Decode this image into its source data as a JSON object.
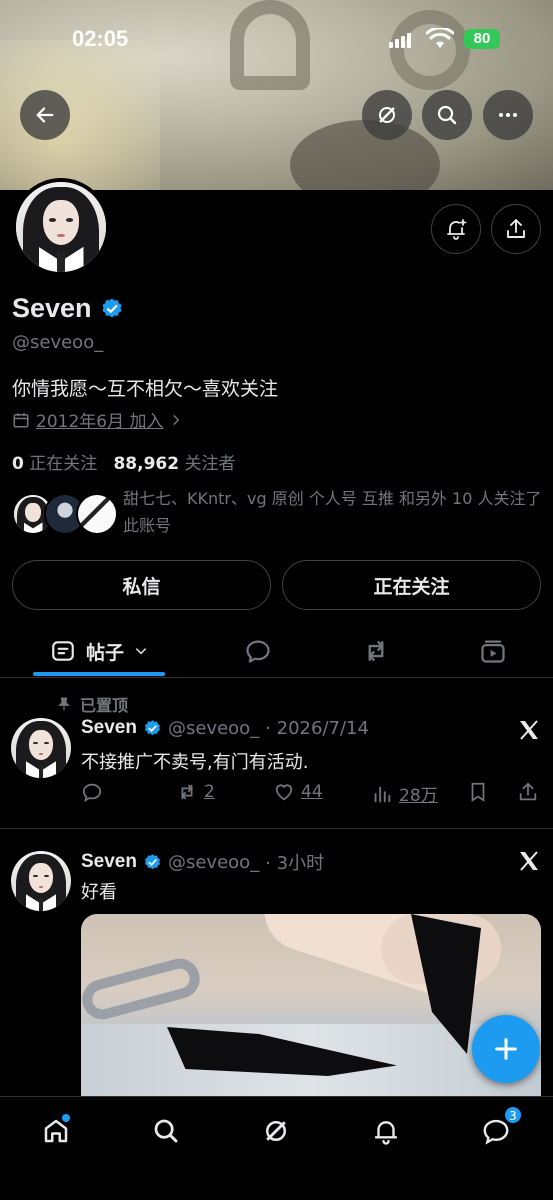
{
  "status_bar": {
    "time": "02:05",
    "battery": "80"
  },
  "profile": {
    "name": "Seven",
    "handle": "@seveoo_",
    "bio": "你情我愿～互不相欠～喜欢关注",
    "joined": "2012年6月 加入",
    "following_count": "0",
    "following_label": "正在关注",
    "followers_count": "88,962",
    "followers_label": "关注者",
    "followed_by": "甜七七、KKntr、vg 原创 个人号 互推 和另外 10 人关注了此账号"
  },
  "actions": {
    "message": "私信",
    "following": "正在关注"
  },
  "tabs": [
    {
      "label": "帖子",
      "icon": "posts-icon"
    },
    {
      "icon": "reply-icon"
    },
    {
      "icon": "repost-icon"
    },
    {
      "icon": "media-icon"
    }
  ],
  "posts": [
    {
      "pinned_label": "已置顶",
      "name": "Seven",
      "handle": "@seveoo_",
      "time": "· 2026/7/14",
      "text": "不接推广不卖号,有门有活动.",
      "reposts": "2",
      "likes": "44",
      "views": "28万"
    },
    {
      "name": "Seven",
      "handle": "@seveoo_",
      "time": "· 3小时",
      "text": "好看"
    }
  ],
  "bottom_nav": {
    "messages_badge": "3"
  },
  "colors": {
    "accent": "#1d9bf0",
    "background": "#000000",
    "muted": "#71767b"
  }
}
